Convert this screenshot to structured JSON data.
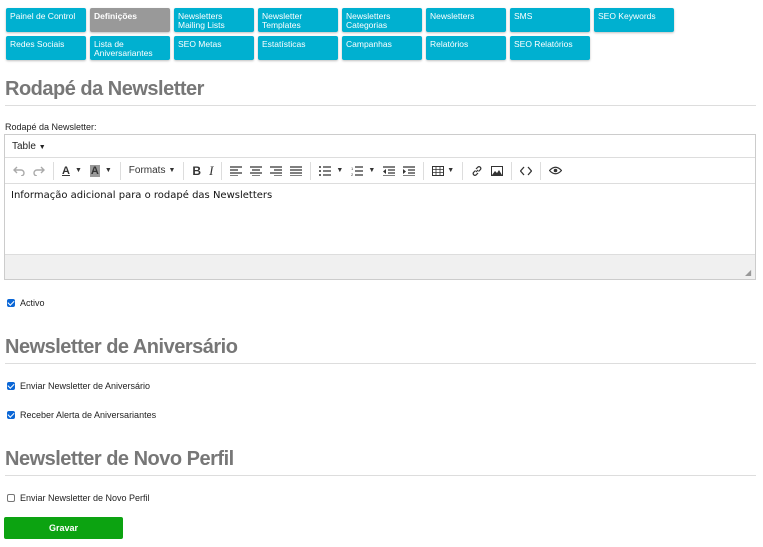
{
  "nav": {
    "row1": [
      {
        "label": "Painel de Control",
        "active": false
      },
      {
        "label": "Definições",
        "active": true
      },
      {
        "label": "Newsletters Mailing Lists",
        "active": false
      },
      {
        "label": "Newsletter Templates",
        "active": false
      },
      {
        "label": "Newsletters Categorias",
        "active": false
      },
      {
        "label": "Newsletters",
        "active": false
      },
      {
        "label": "SMS",
        "active": false
      },
      {
        "label": "SEO Keywords",
        "active": false
      }
    ],
    "row2": [
      {
        "label": "Redes Sociais",
        "active": false
      },
      {
        "label": "Lista de Aniversariantes",
        "active": false
      },
      {
        "label": "SEO Metas",
        "active": false
      },
      {
        "label": "Estatísticas",
        "active": false
      },
      {
        "label": "Campanhas",
        "active": false
      },
      {
        "label": "Relatórios",
        "active": false
      },
      {
        "label": "SEO Relatórios",
        "active": false
      }
    ]
  },
  "footer_section": {
    "title": "Rodapé da Newsletter",
    "field_label": "Rodapé da Newsletter:",
    "menu_table": "Table",
    "formats_label": "Formats",
    "content": "Informação adicional para o rodapé das Newsletters",
    "active_label": "Activo",
    "active_checked": true
  },
  "birthday_section": {
    "title": "Newsletter de Aniversário",
    "send_label": "Enviar Newsletter de Aniversário",
    "send_checked": true,
    "alert_label": "Receber Alerta de Aniversariantes",
    "alert_checked": true
  },
  "profile_section": {
    "title": "Newsletter de Novo Perfil",
    "send_label": "Enviar Newsletter de Novo Perfil",
    "send_checked": false
  },
  "save_label": "Gravar",
  "colors": {
    "nav": "#00b0d0",
    "nav_active": "#999999",
    "save": "#0ca311",
    "title": "#777777"
  }
}
